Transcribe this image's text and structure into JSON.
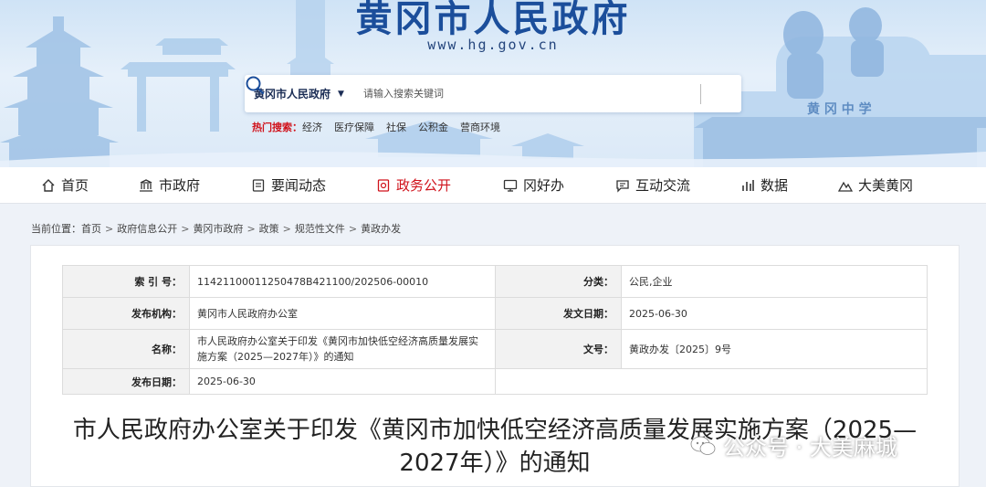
{
  "header": {
    "site_title": "黄冈市人民政府",
    "site_url": "www.hg.gov.cn",
    "scenery_text": "黄 冈 中 学"
  },
  "search": {
    "scope": "黄冈市人民政府",
    "placeholder": "请输入搜索关键词"
  },
  "hot_search": {
    "label": "热门搜索：",
    "items": [
      "经济",
      "医疗保障",
      "社保",
      "公积金",
      "营商环境"
    ]
  },
  "nav": {
    "items": [
      {
        "label": "首页",
        "icon": "home-icon"
      },
      {
        "label": "市政府",
        "icon": "government-building-icon"
      },
      {
        "label": "要闻动态",
        "icon": "news-icon"
      },
      {
        "label": "政务公开",
        "icon": "government-affairs-icon",
        "active": true
      },
      {
        "label": "冈好办",
        "icon": "monitor-icon"
      },
      {
        "label": "互动交流",
        "icon": "message-icon"
      },
      {
        "label": "数据",
        "icon": "data-icon"
      },
      {
        "label": "大美黄冈",
        "icon": "scenery-icon"
      }
    ],
    "active_color": "#d0121b"
  },
  "breadcrumb": {
    "prefix": "当前位置：",
    "items": [
      "首页",
      "政府信息公开",
      "黄冈市政府",
      "政策",
      "规范性文件",
      "黄政办发"
    ],
    "separator": ">"
  },
  "meta": {
    "index_label": "索 引 号：",
    "index_value": "11421100011250478B421100/202506-00010",
    "category_label": "分类：",
    "category_value": "公民,企业",
    "issuer_label": "发布机构：",
    "issuer_value": "黄冈市人民政府办公室",
    "issue_date_label": "发文日期：",
    "issue_date_value": "2025-06-30",
    "name_label": "名称：",
    "name_value": "市人民政府办公室关于印发《黄冈市加快低空经济高质量发展实施方案（2025—2027年）》的通知",
    "doc_no_label": "文号：",
    "doc_no_value": "黄政办发〔2025〕9号",
    "publish_date_label": "发布日期：",
    "publish_date_value": "2025-06-30"
  },
  "document": {
    "title": "市人民政府办公室关于印发《黄冈市加快低空经济高质量发展实施方案（2025—2027年）》的通知"
  },
  "watermark": {
    "text": "公众号 · 大美麻城"
  },
  "colors": {
    "brand_blue": "#1b4e9b",
    "accent_red": "#d0121b"
  }
}
